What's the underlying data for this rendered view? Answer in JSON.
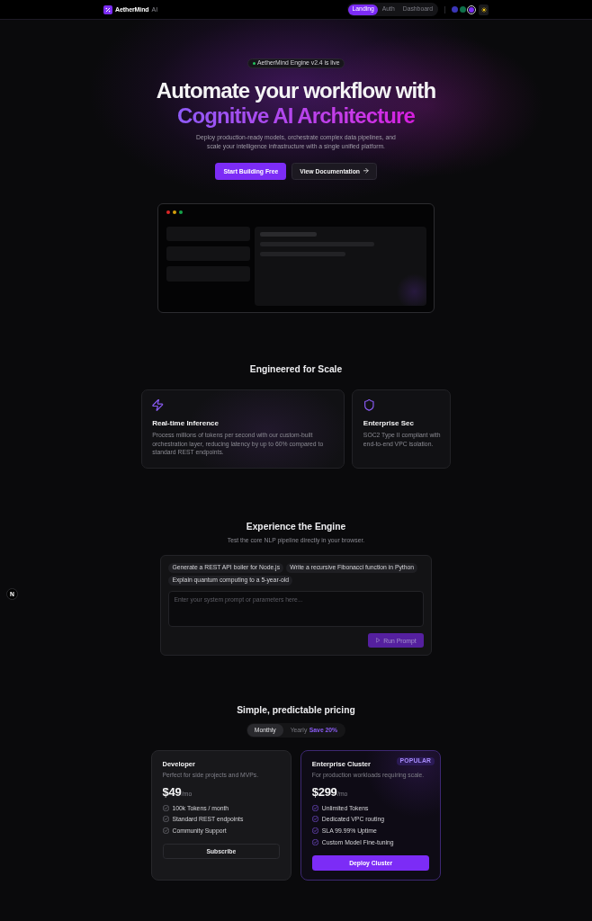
{
  "header": {
    "brand": "AetherMind",
    "brand_suffix": "AI",
    "nav": [
      {
        "label": "Landing",
        "selected": true
      },
      {
        "label": "Auth",
        "selected": false
      },
      {
        "label": "Dashboard",
        "selected": false
      }
    ],
    "theme_swatches": [
      {
        "color": "#3b36b8",
        "selected": false
      },
      {
        "color": "#0f7049",
        "selected": false
      },
      {
        "color": "#7c2cf6",
        "selected": true
      }
    ]
  },
  "hero": {
    "badge": "AetherMind Engine v2.4 is live",
    "title": "Automate your workflow with",
    "title_highlight": "Cognitive AI Architecture",
    "subtitle": "Deploy production-ready models, orchestrate complex data pipelines, and scale your intelligence infrastructure with a single unified platform.",
    "buttons": [
      {
        "label": "Start Building Free",
        "kind": "primary"
      },
      {
        "label": "View Documentation",
        "kind": "secondary"
      }
    ]
  },
  "features": {
    "title": "Engineered for Scale",
    "cards": [
      {
        "title": "Real-time Inference",
        "description": "Process millions of tokens per second with our custom-built orchestration layer, reducing latency by up to 60% compared to standard REST endpoints."
      },
      {
        "title": "Enterprise Sec",
        "description": "SOC2 Type II compliant with end-to-end VPC isolation."
      }
    ]
  },
  "playground": {
    "title": "Experience the Engine",
    "subtitle": "Test the core NLP pipeline directly in your browser.",
    "suggestions": [
      "Generate a REST API boiler for Node.js",
      "Write a recursive Fibonacci function in Python",
      "Explain quantum computing to a 5-year-old"
    ],
    "prompt": {
      "placeholder": "Enter your system prompt or parameters here..."
    },
    "run_button": {
      "label": "Run Prompt",
      "disabled": true
    }
  },
  "pricing": {
    "title": "Simple, predictable pricing",
    "billing": [
      {
        "label": "Monthly",
        "selected": true
      },
      {
        "label": "Yearly",
        "selected": false,
        "note": "Save 20%"
      }
    ],
    "plans": [
      {
        "name": "Developer",
        "description": "Perfect for side projects and MVPs.",
        "price": "$49",
        "period": "/mo",
        "features": [
          "100k Tokens / month",
          "Standard REST endpoints",
          "Community Support"
        ],
        "button": "Subscribe",
        "highlighted": false
      },
      {
        "name": "Enterprise Cluster",
        "badge": "POPULAR",
        "description": "For production workloads requiring scale.",
        "price": "$299",
        "period": "/mo",
        "features": [
          "Unlimited Tokens",
          "Dedicated VPC routing",
          "SLA 99.99% Uptime",
          "Custom Model Fine-tuning"
        ],
        "button": "Deploy Cluster",
        "highlighted": true
      }
    ]
  },
  "dev_badge": {
    "label": "N"
  }
}
